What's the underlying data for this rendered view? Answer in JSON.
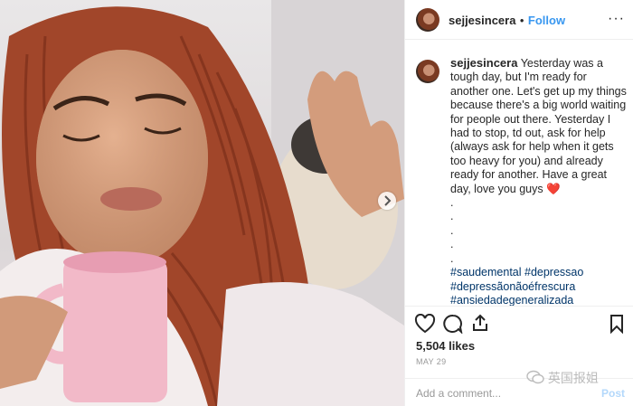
{
  "post": {
    "username": "sejjesincera",
    "separator": "•",
    "follow_label": "Follow",
    "more_label": "···",
    "caption_text": "Yesterday was a tough day, but I'm ready for another one. Let's get up my things because there's a big world waiting for people out there. Yesterday I had to stop, td out, ask for help (always ask for help when it gets too heavy for you) and already ready for another. Have a great day, love you guys",
    "caption_heart": "❤️",
    "dots": [
      ".",
      ".",
      ".",
      ".",
      "."
    ],
    "hashtags": "#saudemental #depressao #depressãonãoéfrescura #ansiedadegeneralizada #whinderssonnunes #loveyourself #unicor #dog #pug #braids #ginger",
    "likes": "5,504 likes",
    "date": "MAY 29",
    "comment_placeholder": "Add a comment...",
    "post_label": "Post"
  },
  "watermark": "英国报姐",
  "icons": {
    "like": "heart-outline-icon",
    "comment": "speech-bubble-icon",
    "share": "share-upload-icon",
    "save": "bookmark-icon",
    "next": "chevron-right-icon",
    "watermark": "wechat-logo-icon"
  },
  "colors": {
    "link": "#3897f0",
    "hashtag": "#003569",
    "text": "#262626",
    "muted": "#999999"
  }
}
